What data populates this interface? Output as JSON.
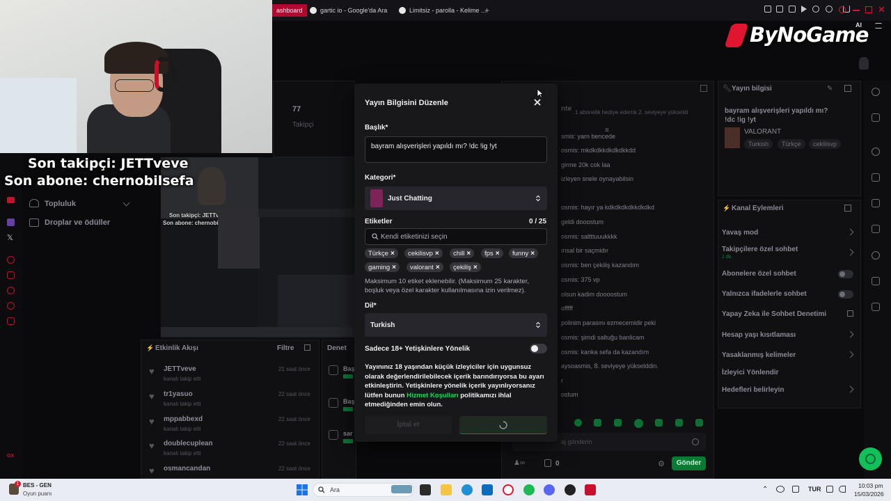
{
  "browser": {
    "tabs": [
      {
        "label": "ashboard",
        "active": true
      },
      {
        "label": "gartic io - Google'da Ara",
        "active": false
      },
      {
        "label": "Limitsiz - parolla - Kelime ...",
        "active": false
      }
    ],
    "new_tab": "+",
    "ai_label": "AI"
  },
  "overlay": {
    "last_follower": "Son takipçi: JETTveve",
    "last_sub": "Son abone: chernobilsefa",
    "logo": "ByNoGame"
  },
  "dashboard": {
    "followers_count": "77",
    "followers_label": "Takipçi",
    "nav": {
      "community": "Topluluk",
      "drops": "Droplar ve ödüller"
    },
    "activity": {
      "title": "Etkinlik Akışı",
      "filter": "Filtre",
      "items": [
        {
          "name": "JETTveve",
          "sub": "kanalı takip etti",
          "time": "21 saat önce"
        },
        {
          "name": "tr1yasuo",
          "sub": "kanalı takip etti",
          "time": "22 saat önce"
        },
        {
          "name": "mppabbexd",
          "sub": "kanalı takip etti",
          "time": "22 saat önce"
        },
        {
          "name": "doublecuplean",
          "sub": "kanalı takip etti",
          "time": "22 saat önce"
        },
        {
          "name": "osmancandan",
          "sub": "",
          "time": "22 saat önce"
        }
      ]
    },
    "mid_panel": {
      "title": "Denet",
      "items": [
        "Baş",
        "Baş",
        "sar"
      ]
    },
    "chat": {
      "top_notice": "1 abonelik hediye edernk 2. seviyeye yükseldi",
      "lines": [
        "smis: yarn bencede",
        "osmis: mkdkdkkdkdkdkkdd",
        "girme 20k cok laa",
        "izleyen snele oynayabilsin",
        "osmis: hayır ya kdkdkdkdkkdkdkd",
        "geldi dooostum",
        "osmis: saltttuuukkkk",
        "ınsal bir saçmidır",
        "osmis: ben çekiliş kazandım",
        "osmis: 375 vp",
        "olsun kadim doooostum",
        "offfff",
        "polinim parasını ezmecemidir peki",
        "osmis: şimdi saltuğu banlicam",
        "osmis: kanka sefa da kazandım",
        "aysoasmis, 8. seviyeye yükselddin.",
        "r",
        "ostum"
      ],
      "input_placeholder": "aj gönderin",
      "points": "0",
      "send": "Gönder"
    },
    "stream_info": {
      "title": "Yayın bilgisi",
      "text": "bayram alışverişleri yapıldı mı? !dc !ig !yt",
      "game": "VALORANT",
      "tags": [
        "Turkish",
        "Türkçe",
        "cekilisvp"
      ]
    },
    "channel_actions": {
      "title": "Kanal Eylemleri",
      "items": [
        {
          "label": "Yavaş mod",
          "sub": "",
          "control": "chevron"
        },
        {
          "label": "Takipçilere özel sohbet",
          "sub": "1 dk.",
          "control": "chevron"
        },
        {
          "label": "Abonelere özel sohbet",
          "sub": "",
          "control": "toggle"
        },
        {
          "label": "Yalnızca ifadelerle sohbet",
          "sub": "",
          "control": "toggle"
        },
        {
          "label": "Yapay Zeka ile Sohbet Denetimi",
          "sub": "",
          "control": "link"
        },
        {
          "label": "Hesap yaşı kısıtlaması",
          "sub": "",
          "control": "chevron"
        },
        {
          "label": "Yasaklanmış kelimeler",
          "sub": "",
          "control": "chevron"
        },
        {
          "label": "İzleyici Yönlendir",
          "sub": "",
          "control": "none"
        },
        {
          "label": "Hedefleri belirleyin",
          "sub": "",
          "control": "chevron"
        }
      ]
    },
    "preview": {
      "line1": "Son takipçi: JETTveve",
      "line2": "Son abone: chernobilsefa"
    }
  },
  "modal": {
    "title": "Yayın Bilgisini Düzenle",
    "title_label": "Başlık*",
    "title_value": "bayram alışverişleri yapıldı mı? !dc !ig !yt",
    "category_label": "Kategori*",
    "category_value": "Just Chatting",
    "tags_label": "Etiketler",
    "tags_count": "0 / 25",
    "tags_placeholder": "Kendi etiketinizi seçin",
    "tags": [
      "Türkçe",
      "cekilisvp",
      "chill",
      "fps",
      "funny",
      "gaming",
      "valorant",
      "çekiliş"
    ],
    "tags_help": "Maksimum 10 etiket eklenebilir. (Maksimum 25 karakter, boşluk veya özel karakter kullanılmasına izin verilmez).",
    "language_label": "Dil*",
    "language_value": "Turkish",
    "adult_label": "Sadece 18+ Yetişkinlere Yönelik",
    "adult_on": false,
    "warning_part1": "Yayınınız 18 yaşından küçük izleyiciler için uygunsuz olarak değerlendirilebilecek içerik barındırıyorsa bu ayarı etkinleştirin. Yetişkinlere yönelik içerik yayınlıyorsanız lütfen bunun ",
    "warning_link": "Hizmet Koşulları",
    "warning_part2": " politikamızı ihlal etmediğinden emin olun.",
    "cancel": "İptal et"
  },
  "taskbar": {
    "app_title": "BES - GEN",
    "app_sub": "Oyun puanı",
    "badge": "1",
    "search": "Ara",
    "lang": "TUR",
    "time": "10:03 pm",
    "date": "15/03/2026"
  },
  "colors": {
    "accent_green": "#00e05a",
    "brand_red": "#e0152f",
    "modal_bg": "#18181b"
  }
}
